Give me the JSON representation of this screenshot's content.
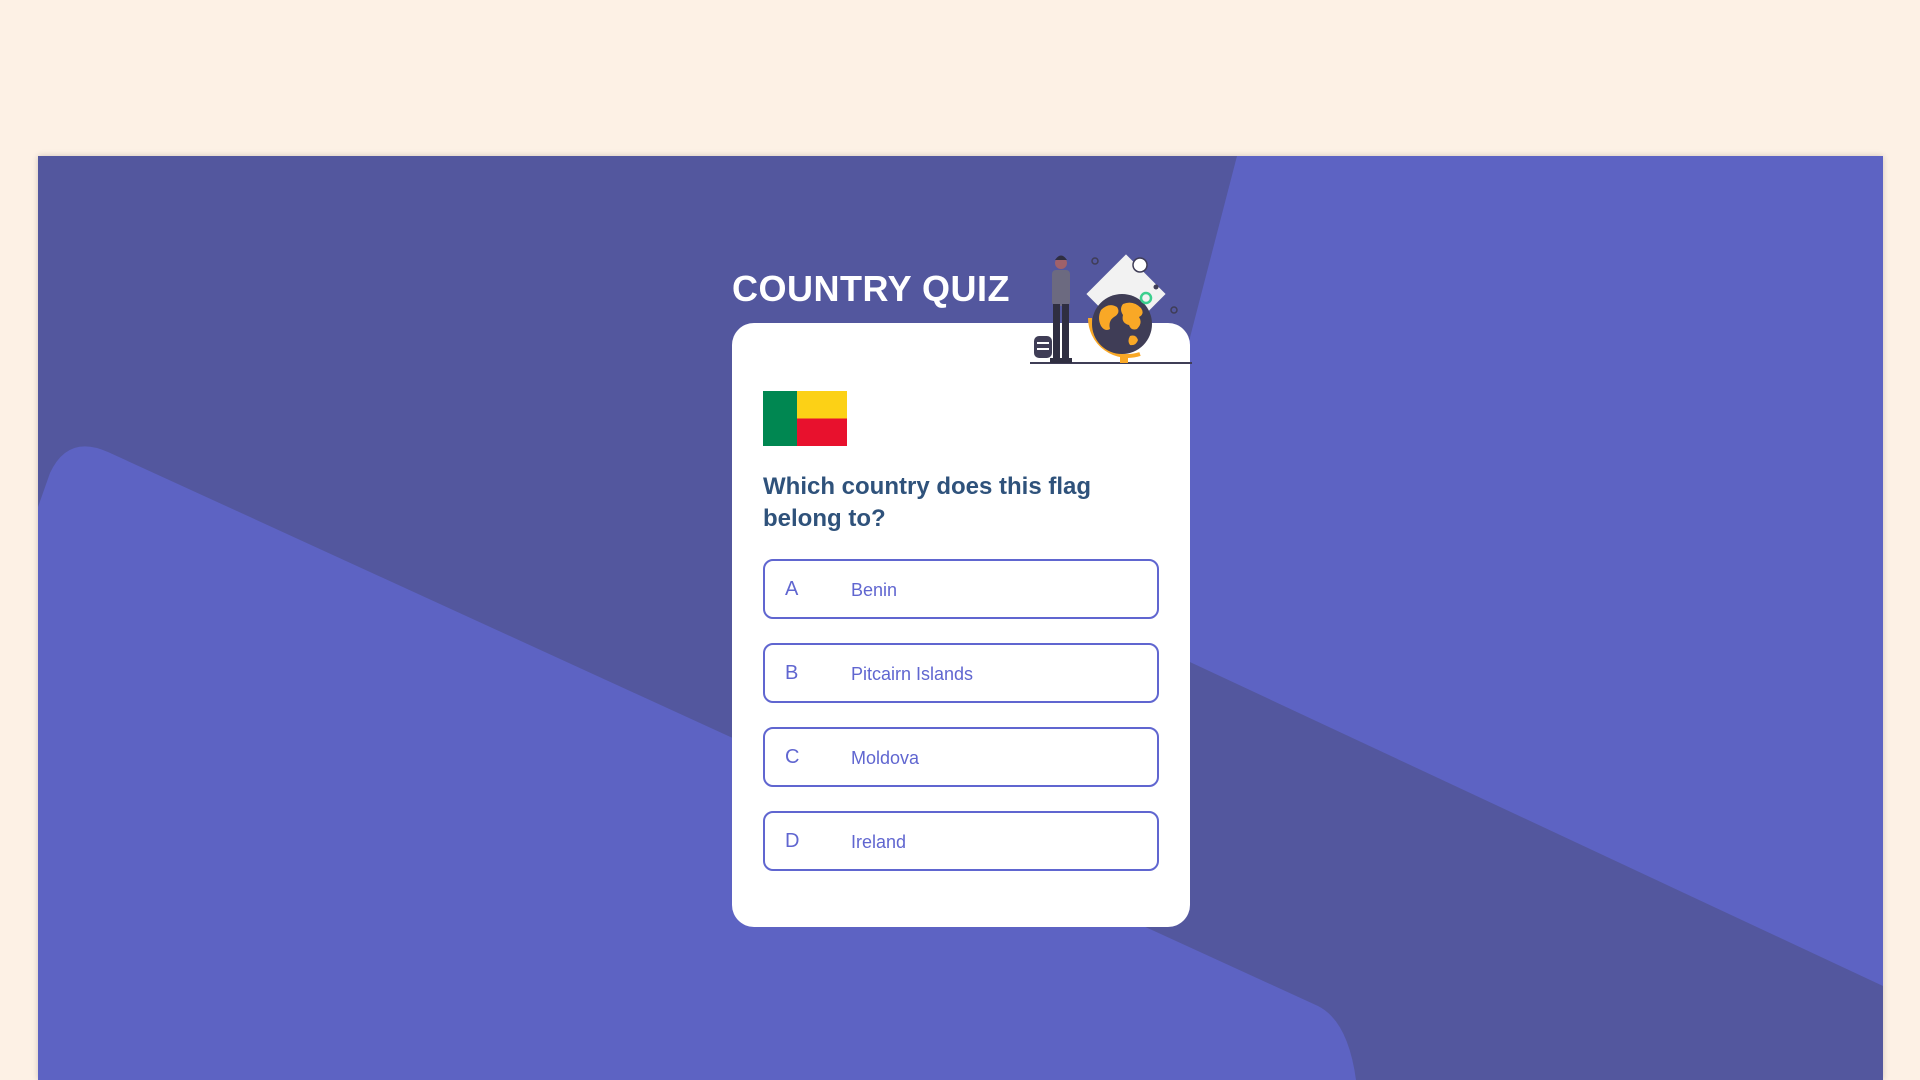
{
  "app": {
    "title": "COUNTRY QUIZ"
  },
  "quiz": {
    "flag_country": "Benin",
    "flag_colors": {
      "green": "#008751",
      "yellow": "#fcd116",
      "red": "#e8112d"
    },
    "question": "Which country does this flag belong to?",
    "options": [
      {
        "letter": "A",
        "text": "Benin"
      },
      {
        "letter": "B",
        "text": "Pitcairn Islands"
      },
      {
        "letter": "C",
        "text": "Moldova"
      },
      {
        "letter": "D",
        "text": "Ireland"
      }
    ]
  },
  "theme": {
    "page_background": "#fdf1e5",
    "stage_dark": "#53579e",
    "stage_light": "#5d63c3",
    "accent": "#6066d0",
    "question_color": "#2f527b",
    "card_background": "#ffffff"
  },
  "icons": {
    "illustration": "traveler-with-globe-illustration",
    "flag": "benin-flag"
  }
}
